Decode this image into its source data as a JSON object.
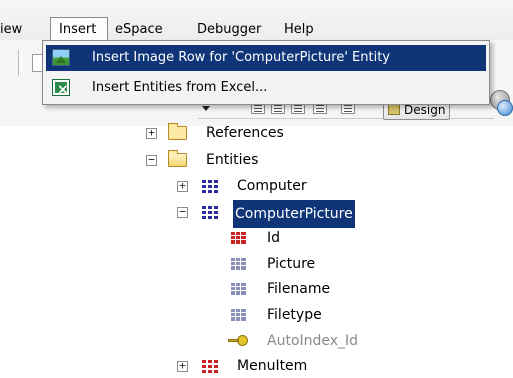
{
  "menubar": {
    "items": [
      "iew",
      "Insert",
      "eSpace",
      "Debugger",
      "Help"
    ]
  },
  "dropdown": {
    "items": [
      {
        "label": "Insert Image Row for 'ComputerPicture' Entity",
        "icon": "image-row-icon",
        "highlighted": true
      },
      {
        "label": "Insert Entities from Excel...",
        "icon": "excel-icon",
        "highlighted": false
      }
    ]
  },
  "toolbar": {
    "design_label": "Design"
  },
  "tree": {
    "references": "References",
    "entities": "Entities",
    "computer": "Computer",
    "computer_picture": "ComputerPicture",
    "attributes": [
      "Id",
      "Picture",
      "Filename",
      "Filetype",
      "AutoIndex_Id"
    ],
    "menu_item": "MenuItem"
  },
  "colors": {
    "selection": "#0f3578",
    "entity_icon": "#2b2aa0",
    "id_icon": "#c92424",
    "greyed_text": "#8a8a8a"
  }
}
